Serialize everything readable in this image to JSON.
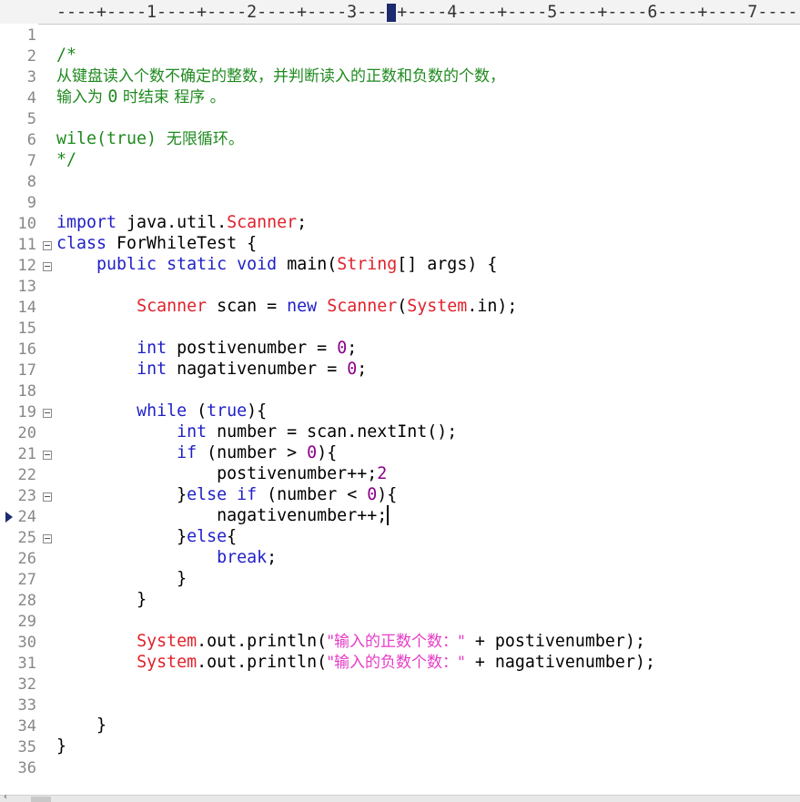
{
  "ruler": {
    "text": "----+----1----+----2----+----3----+----4----+----5----+----6----+----7----"
  },
  "gutter": {
    "line_numbers": [
      "1",
      "2",
      "3",
      "4",
      "5",
      "6",
      "7",
      "8",
      "9",
      "10",
      "11",
      "12",
      "13",
      "14",
      "15",
      "16",
      "17",
      "18",
      "19",
      "20",
      "21",
      "22",
      "23",
      "24",
      "25",
      "26",
      "27",
      "28",
      "29",
      "30",
      "31",
      "32",
      "33",
      "34",
      "35",
      "36"
    ],
    "current_line": "24"
  },
  "code": {
    "l2": "/*",
    "l3": "从键盘读入个数不确定的整数，并判断读入的正数和负数的个数，",
    "l4_a": "输入为 ",
    "l4_b": "0",
    "l4_c": " 时结束 程序 。",
    "l6_a": "wile(true)",
    "l6_b": "  无限循环。",
    "l7": "*/",
    "l10_import": "import",
    "l10_pkg": " java.util.",
    "l10_scanner": "Scanner",
    "l10_semi": ";",
    "l11_class": "class",
    "l11_name": " ForWhileTest {",
    "l12_public": "public",
    "l12_static": "static",
    "l12_void": "void",
    "l12_main": " main(",
    "l12_string": "String",
    "l12_rest": "[] args) {",
    "l14_scanner1": "Scanner",
    "l14_scan": " scan = ",
    "l14_new": "new",
    "l14_scanner2": "Scanner",
    "l14_paren": "(",
    "l14_system": "System",
    "l14_in": ".in);",
    "l16_int": "int",
    "l16_var": " postivenumber = ",
    "l16_zero": "0",
    "l16_semi": ";",
    "l17_int": "int",
    "l17_var": " nagativenumber = ",
    "l17_zero": "0",
    "l17_semi": ";",
    "l19_while": "while",
    "l19_open": " (",
    "l19_true": "true",
    "l19_close": "){",
    "l20_int": "int",
    "l20_rest": " number = scan.nextInt();",
    "l21_if": "if",
    "l21_cond": " (number > ",
    "l21_zero": "0",
    "l21_close": "){",
    "l22_stmt": "postivenumber++;",
    "l22_two": "2",
    "l23_close": "}",
    "l23_else": "else",
    "l23_if": "if",
    "l23_cond": " (number < ",
    "l23_zero": "0",
    "l23_brace": "){",
    "l24_stmt": "nagativenumber++;",
    "l25_close": "}",
    "l25_else": "else",
    "l25_brace": "{",
    "l26_break": "break",
    "l26_semi": ";",
    "l27": "}",
    "l28": "}",
    "l30_system": "System",
    "l30_call": ".out.println(",
    "l30_str": "\"输入的正数个数：\"",
    "l30_rest": " + postivenumber);",
    "l31_system": "System",
    "l31_call": ".out.println(",
    "l31_str": "\"输入的负数个数：\"",
    "l31_rest": " + nagativenumber);",
    "l34": "}",
    "l35": "}"
  },
  "colors": {
    "comment": "#1f8a1f",
    "keyword": "#1f1fc8",
    "class": "#e0212b",
    "number": "#8b008b",
    "string": "#e63cc8",
    "line_number": "#888888"
  }
}
